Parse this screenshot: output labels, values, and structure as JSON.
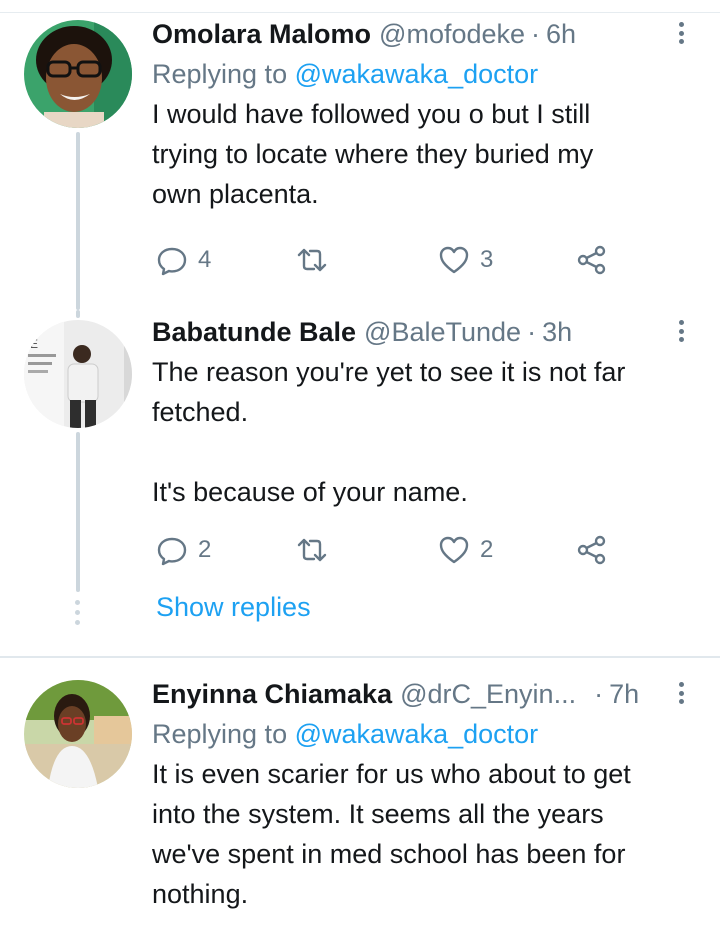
{
  "tweets": [
    {
      "name": "Omolara Malomo",
      "handle": "@mofodeke",
      "time": "6h",
      "replying_prefix": "Replying to",
      "replying_to": "@wakawaka_doctor",
      "text_lines": [
        "I would have followed you o but I still",
        "trying to locate where they buried my",
        "own placenta."
      ],
      "replies": "4",
      "retweets": "",
      "likes": "3"
    },
    {
      "name": "Babatunde Bale",
      "handle": "@BaleTunde",
      "time": "3h",
      "text_lines": [
        "The reason you're yet to see it is not far",
        "fetched.",
        "",
        "It's because of your name."
      ],
      "replies": "2",
      "retweets": "",
      "likes": "2",
      "show_replies": "Show replies"
    },
    {
      "name": "Enyinna Chiamaka",
      "handle": "@drC_Enyin...",
      "time": "7h",
      "replying_prefix": "Replying to",
      "replying_to": "@wakawaka_doctor",
      "text_lines": [
        "It is even scarier for us who about to get",
        "into the system. It seems all the years",
        "we've spent in med school has been for",
        "nothing."
      ]
    }
  ],
  "icons": {
    "reply": "reply-icon",
    "retweet": "retweet-icon",
    "like": "heart-icon",
    "share": "share-icon",
    "more": "more-vertical-icon"
  },
  "colors": {
    "link": "#1da1f2",
    "secondary": "#657786",
    "thread_line": "#ccd6dd"
  }
}
